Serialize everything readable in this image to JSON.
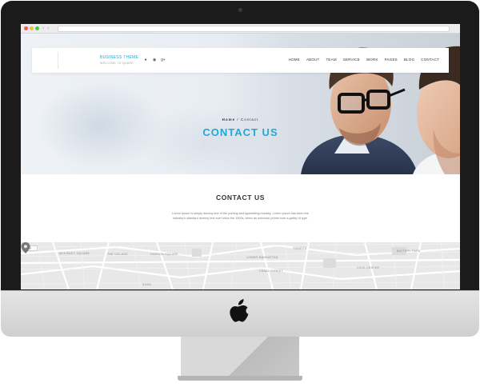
{
  "brand": {
    "name": "BUSINESS THEME",
    "tagline": "WELCOME TO QUARK"
  },
  "social": [
    "pinterest-icon",
    "dribbble-icon",
    "google-plus-icon"
  ],
  "social_glyphs": [
    "●",
    "◉",
    "g+"
  ],
  "menu": {
    "items": [
      "HOME",
      "ABOUT",
      "TEAM",
      "SERVICE",
      "WORK",
      "PAGES",
      "BLOG",
      "CONTACT"
    ]
  },
  "hero": {
    "breadcrumb_home": "Home",
    "breadcrumb_separator": "/",
    "breadcrumb_current": "Contact",
    "title": "CONTACT US"
  },
  "contact": {
    "title": "CONTACT US",
    "text": "Lorem Ipsum is simply dummy text of the printing and typesetting industry. Lorem Ipsum has been the industry's standard dummy text ever since the 1500s, when an unknown printer took a galley of type."
  },
  "map": {
    "button": "Map",
    "labels": [
      "MCKINLEY SQUARE",
      "THE VILLAGE",
      "HUDSON SQUARE",
      "LOWER MANHATTAN",
      "TRIBECA",
      "BATTERY PARK",
      "CANAL STREET",
      "CIVIC CENTER",
      "SOHO"
    ]
  },
  "colors": {
    "accent": "#1fa8d9",
    "bezel": "#1b1b1b"
  }
}
